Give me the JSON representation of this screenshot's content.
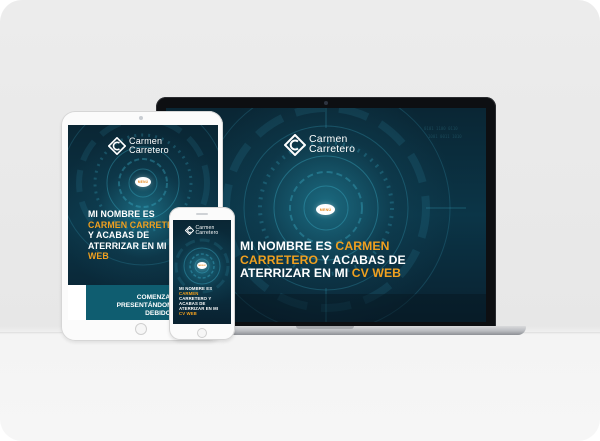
{
  "brand": {
    "first_name": "Carmen",
    "last_name": "Carretero"
  },
  "menu_label": "MENÚ",
  "laptop": {
    "headline_line1_a": "MI NOMBRE ES ",
    "headline_line1_b": "CARMEN",
    "headline_line2_a": "CARRETERO",
    "headline_line2_b": " Y ACABAS DE",
    "headline_line3_a": "ATERRIZAR EN MI ",
    "headline_line3_b": "CV WEB"
  },
  "tablet": {
    "headline_line1": "MI NOMBRE ES",
    "headline_line2": "CARMEN CARRETE",
    "headline_line3": "Y ACABAS DE",
    "headline_line4": "ATERRIZAR EN MI",
    "headline_line5": "WEB",
    "banner_line1": "COMENZARÉ",
    "banner_line2": "PRESENTÁNDOME COMO",
    "banner_line3": "DEBIDO"
  },
  "phone": {
    "headline_line1": "MI NOMBRE ES",
    "headline_line2": "CARMEN",
    "headline_line3": "CARRETERO Y",
    "headline_line4": "ACABAS DE",
    "headline_line5": "ATERRIZAR EN MI",
    "headline_line6": "CV WEB"
  },
  "colors": {
    "accent_orange": "#f0a01f",
    "teal_dark": "#0b3547",
    "banner_teal": "#0f5d70"
  }
}
